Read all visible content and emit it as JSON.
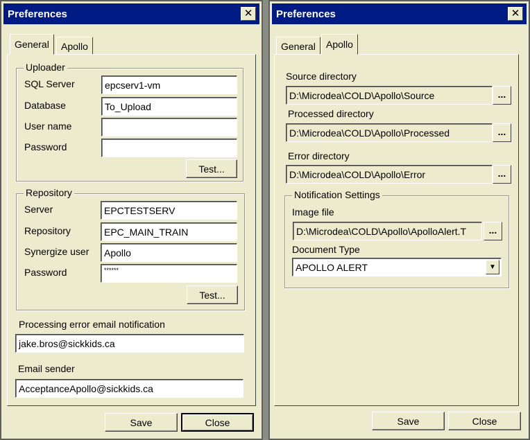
{
  "left": {
    "title": "Preferences",
    "close_glyph": "✕",
    "tabs": [
      {
        "label": "General"
      },
      {
        "label": "Apollo"
      }
    ],
    "uploader": {
      "legend": "Uploader",
      "sql_server_label": "SQL Server",
      "sql_server_value": "epcserv1-vm",
      "database_label": "Database",
      "database_value": "To_Upload",
      "username_label": "User name",
      "username_value": "",
      "password_label": "Password",
      "password_value": "",
      "test_label": "Test..."
    },
    "repository": {
      "legend": "Repository",
      "server_label": "Server",
      "server_value": "EPCTESTSERV",
      "repository_label": "Repository",
      "repository_value": "EPC_MAIN_TRAIN",
      "user_label": "Synergize user",
      "user_value": "Apollo",
      "password_label": "Password",
      "password_value": "******",
      "test_label": "Test..."
    },
    "email_notification_label": "Processing error email notification",
    "email_notification_value": "jake.bros@sickkids.ca",
    "email_sender_label": "Email sender",
    "email_sender_value": "AcceptanceApollo@sickkids.ca",
    "save_label": "Save",
    "close_label": "Close"
  },
  "right": {
    "title": "Preferences",
    "close_glyph": "✕",
    "tabs": [
      {
        "label": "General"
      },
      {
        "label": "Apollo"
      }
    ],
    "source_label": "Source directory",
    "source_value": "D:\\Microdea\\COLD\\Apollo\\Source",
    "processed_label": "Processed directory",
    "processed_value": "D:\\Microdea\\COLD\\Apollo\\Processed",
    "error_label": "Error directory",
    "error_value": "D:\\Microdea\\COLD\\Apollo\\Error",
    "browse_label": "...",
    "notification": {
      "legend": "Notification Settings",
      "image_label": "Image file",
      "image_value": "D:\\Microdea\\COLD\\Apollo\\ApolloAlert.T",
      "doctype_label": "Document Type",
      "doctype_value": "APOLLO ALERT",
      "dropdown_glyph": "▼"
    },
    "save_label": "Save",
    "close_label": "Close"
  }
}
